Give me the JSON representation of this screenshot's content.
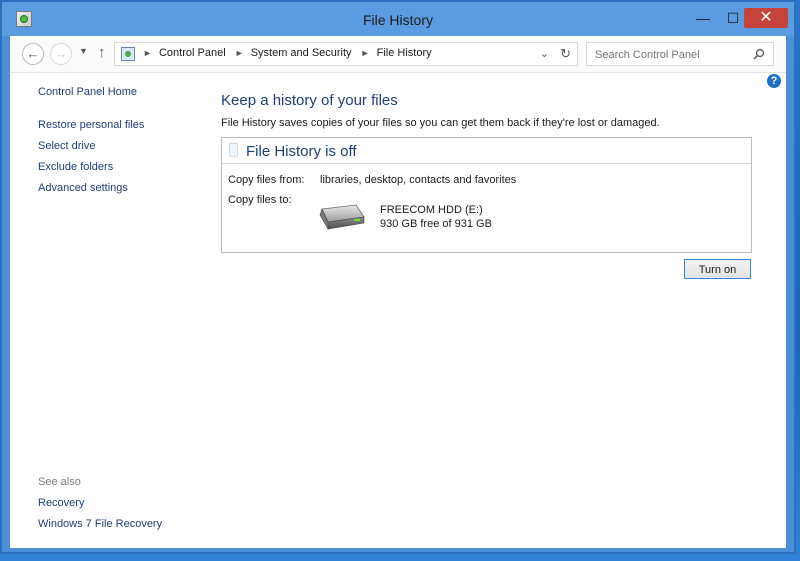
{
  "window": {
    "title": "File History",
    "controls": {
      "minimize": "—",
      "maximize": "☐",
      "close": "✕"
    }
  },
  "navbar": {
    "breadcrumbs": [
      "Control Panel",
      "System and Security",
      "File History"
    ],
    "search_placeholder": "Search Control Panel"
  },
  "sidebar": {
    "home": "Control Panel Home",
    "links": [
      "Restore personal files",
      "Select drive",
      "Exclude folders",
      "Advanced settings"
    ],
    "see_also_label": "See also",
    "see_also_links": [
      "Recovery",
      "Windows 7 File Recovery"
    ]
  },
  "main": {
    "heading": "Keep a history of your files",
    "description": "File History saves copies of your files so you can get them back if they're lost or damaged.",
    "status_title": "File History is off",
    "copy_from_label": "Copy files from:",
    "copy_from_value": "libraries, desktop, contacts and favorites",
    "copy_to_label": "Copy files to:",
    "drive_name": "FREECOM HDD (E:)",
    "drive_free": "930 GB free of 931 GB",
    "turn_on_label": "Turn on"
  },
  "colors": {
    "link": "#1e3f77",
    "titlebar": "#5b9be0",
    "close_button": "#c7433a",
    "help": "#1e70c7"
  },
  "icons": [
    "app-icon",
    "back-icon",
    "forward-icon",
    "up-icon",
    "refresh-icon",
    "search-icon",
    "help-icon",
    "hard-drive-icon"
  ]
}
